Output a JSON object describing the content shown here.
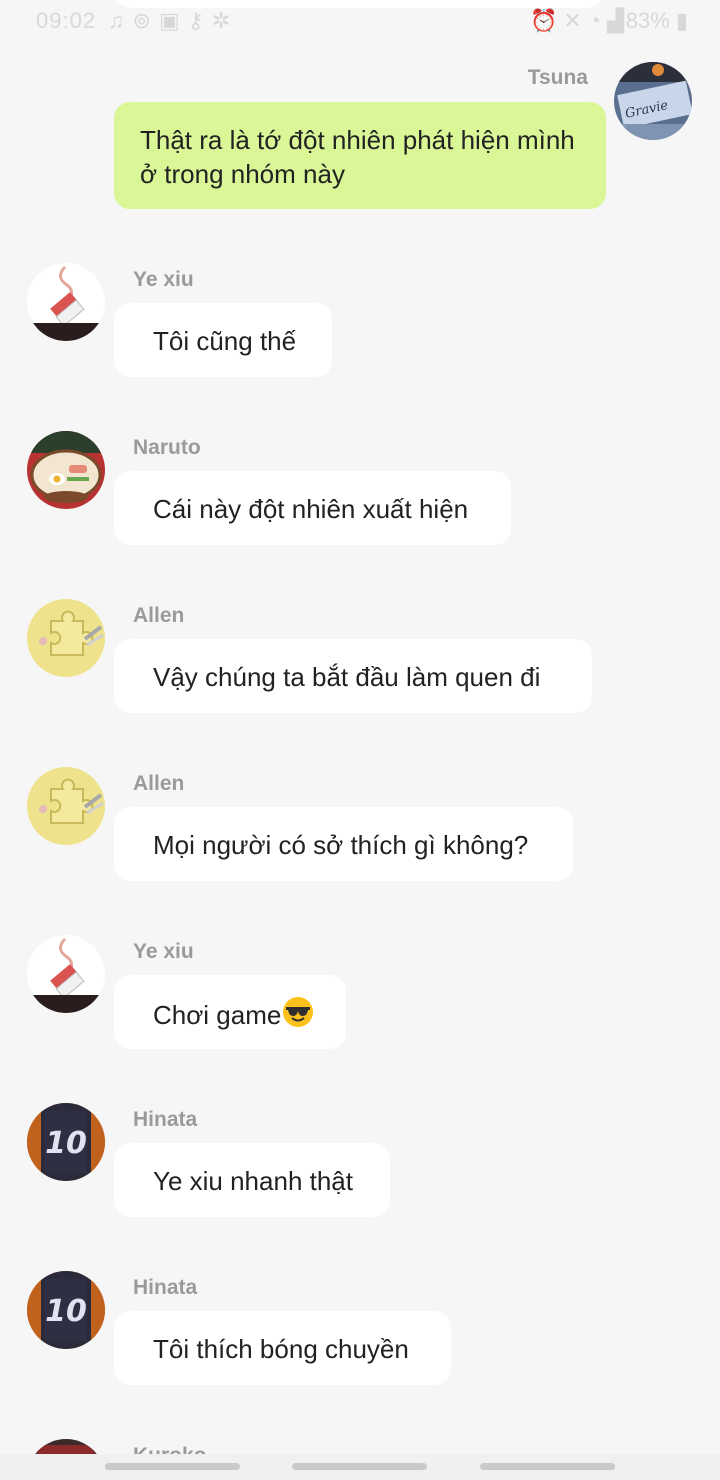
{
  "status": {
    "time": "09:02",
    "battery": "83%",
    "left_icons": [
      "music-note-icon",
      "accessibility-icon",
      "image-icon",
      "key-icon",
      "person-icon"
    ],
    "right_icons": [
      "alarm-icon",
      "mute-icon",
      "wifi-icon",
      "signal-icon",
      "battery-icon"
    ]
  },
  "colors": {
    "background": "#f6f6f6",
    "self_bubble": "#d9f797",
    "other_bubble": "#ffffff",
    "sender_name": "#9a9a9a"
  },
  "messages": [
    {
      "sender": "Tsuna",
      "text": "Thật ra là tớ đột nhiên phát hiện mình ở trong nhóm này",
      "self": true,
      "avatar": "graffiti-avatar"
    },
    {
      "sender": "Ye xiu",
      "text": "Tôi cũng thế",
      "self": false,
      "avatar": "cigarette-avatar"
    },
    {
      "sender": "Naruto",
      "text": "Cái này đột nhiên xuất hiện",
      "self": false,
      "avatar": "ramen-avatar"
    },
    {
      "sender": "Allen",
      "text": "Vậy chúng ta bắt đầu làm quen đi",
      "self": false,
      "avatar": "puzzle-avatar"
    },
    {
      "sender": "Allen",
      "text": "Mọi người có sở thích gì không?",
      "self": false,
      "avatar": "puzzle-avatar"
    },
    {
      "sender": "Ye xiu",
      "text": "Chơi game",
      "emoji": "sunglasses-emoji",
      "self": false,
      "avatar": "cigarette-avatar"
    },
    {
      "sender": "Hinata",
      "text": "Ye xiu nhanh thật",
      "self": false,
      "avatar": "jersey-avatar"
    },
    {
      "sender": "Hinata",
      "text": "Tôi thích bóng chuyền",
      "self": false,
      "avatar": "jersey-avatar"
    },
    {
      "sender": "Kuroko",
      "text": "",
      "self": false,
      "avatar": "partial-avatar"
    }
  ],
  "avatar_text": {
    "jersey_number": "10",
    "graffiti": "Gravie"
  }
}
